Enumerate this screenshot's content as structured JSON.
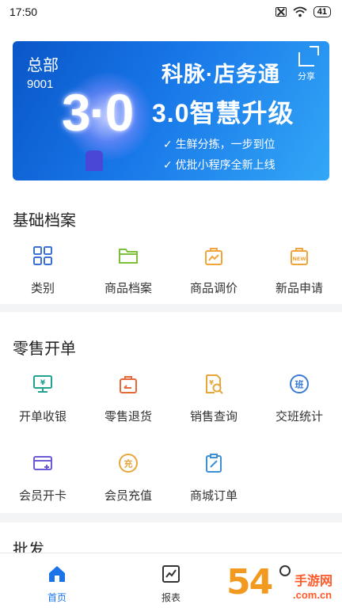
{
  "status_bar": {
    "time": "17:50",
    "battery": "41"
  },
  "banner": {
    "store_name": "总部",
    "store_id": "9001",
    "brand": "科脉·店务通",
    "big_text": "3·0",
    "upgrade_text": "3.0智慧升级",
    "features": [
      "生鲜分拣，一步到位",
      "优批小程序全新上线"
    ],
    "share_label": "分享"
  },
  "sections": [
    {
      "title": "基础档案",
      "items": [
        {
          "label": "类别",
          "icon": "grid-icon",
          "color": "#3b6fd6"
        },
        {
          "label": "商品档案",
          "icon": "folder-icon",
          "color": "#7cbf3b"
        },
        {
          "label": "商品调价",
          "icon": "price-bag-icon",
          "color": "#f2a43a"
        },
        {
          "label": "新品申请",
          "icon": "new-bag-icon",
          "color": "#f2a43a"
        }
      ]
    },
    {
      "title": "零售开单",
      "items": [
        {
          "label": "开单收银",
          "icon": "cashier-icon",
          "color": "#22a38f"
        },
        {
          "label": "零售退货",
          "icon": "return-bag-icon",
          "color": "#e8683a"
        },
        {
          "label": "销售查询",
          "icon": "sales-query-icon",
          "color": "#e8a53a"
        },
        {
          "label": "交班统计",
          "icon": "shift-icon",
          "color": "#3b7bd6"
        },
        {
          "label": "会员开卡",
          "icon": "member-card-icon",
          "color": "#6a5ad6"
        },
        {
          "label": "会员充值",
          "icon": "recharge-icon",
          "color": "#e8a53a"
        },
        {
          "label": "商城订单",
          "icon": "order-icon",
          "color": "#3b8fd6"
        }
      ]
    },
    {
      "title": "批发",
      "items": []
    }
  ],
  "tabbar": [
    {
      "label": "首页",
      "icon": "home-icon",
      "active": true
    },
    {
      "label": "报表",
      "icon": "report-icon",
      "active": false
    },
    {
      "label": "",
      "icon": "profile-icon",
      "active": false
    }
  ],
  "watermark": {
    "number": "54",
    "text": "手游网",
    "url": ".com.cn"
  },
  "colors": {
    "accent": "#1a73e8",
    "banner": "#1877e8"
  }
}
